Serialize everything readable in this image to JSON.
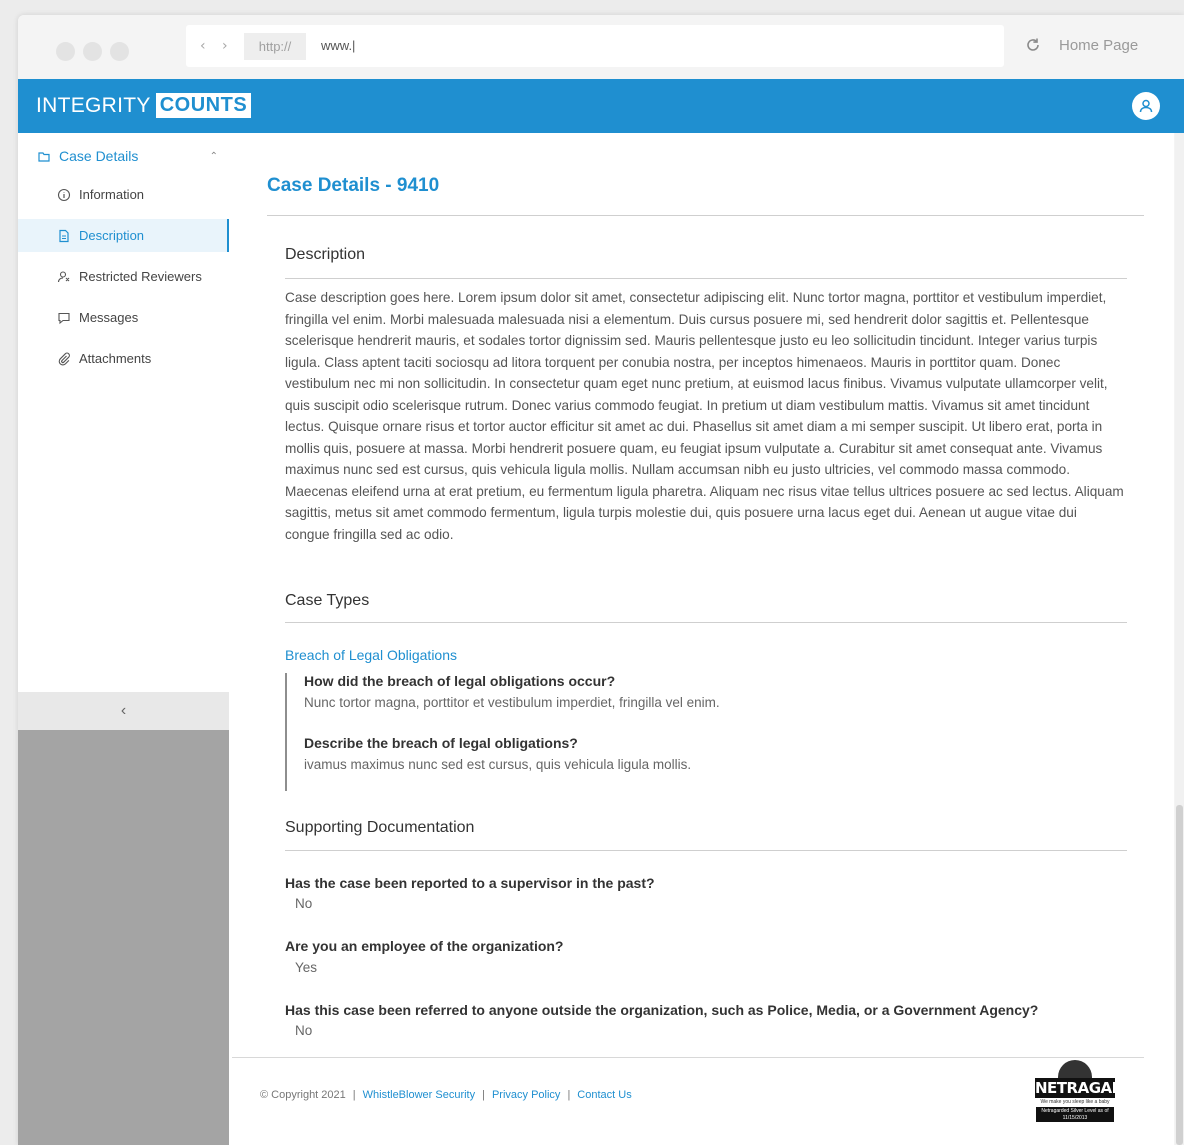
{
  "browser": {
    "nav_arrows": "‹ ›",
    "protocol": "http://",
    "url": "www.|",
    "home_label": "Home Page"
  },
  "header": {
    "logo_part1": "INTEGRITY",
    "logo_part2": "COUNTS",
    "accent_color": "#1f8fd0"
  },
  "sidebar": {
    "section_label": "Case Details",
    "items": [
      {
        "label": "Information",
        "icon": "info-icon"
      },
      {
        "label": "Description",
        "icon": "document-icon",
        "active": true
      },
      {
        "label": "Restricted Reviewers",
        "icon": "reviewers-icon"
      },
      {
        "label": "Messages",
        "icon": "message-icon"
      },
      {
        "label": "Attachments",
        "icon": "paperclip-icon"
      }
    ],
    "collapse_glyph": "‹"
  },
  "main": {
    "title": "Case Details - 9410",
    "description_heading": "Description",
    "description_text": "Case description goes here. Lorem ipsum dolor sit amet, consectetur adipiscing elit. Nunc tortor magna, porttitor et vestibulum imperdiet, fringilla vel enim. Morbi malesuada malesuada nisi a elementum. Duis cursus posuere mi, sed hendrerit dolor sagittis et. Pellentesque scelerisque hendrerit mauris, et sodales tortor dignissim sed. Mauris pellentesque justo eu leo sollicitudin tincidunt. Integer varius turpis ligula. Class aptent taciti sociosqu ad litora torquent per conubia nostra, per inceptos himenaeos. Mauris in porttitor quam. Donec vestibulum nec mi non sollicitudin. In consectetur quam eget nunc pretium, at euismod lacus finibus. Vivamus vulputate ullamcorper velit, quis suscipit odio scelerisque rutrum. Donec varius commodo feugiat. In pretium ut diam vestibulum mattis. Vivamus sit amet tincidunt lectus. Quisque ornare risus et tortor auctor efficitur sit amet ac dui. Phasellus sit amet diam a mi semper suscipit. Ut libero erat, porta in mollis quis, posuere at massa. Morbi hendrerit posuere quam, eu feugiat ipsum vulputate a. Curabitur sit amet consequat ante. Vivamus maximus nunc sed est cursus, quis vehicula ligula mollis. Nullam accumsan nibh eu justo ultricies, vel commodo massa commodo. Maecenas eleifend urna at erat pretium, eu fermentum ligula pharetra. Aliquam nec risus vitae tellus ultrices posuere ac sed lectus. Aliquam sagittis, metus sit amet commodo fermentum, ligula turpis molestie dui, quis posuere urna lacus eget dui. Aenean ut augue vitae dui congue fringilla sed ac odio.",
    "case_types_heading": "Case Types",
    "case_type_link": "Breach of Legal Obligations",
    "case_type_qa": [
      {
        "q": "How did the breach of legal obligations occur?",
        "a": "Nunc tortor magna, porttitor et vestibulum imperdiet, fringilla vel enim."
      },
      {
        "q": "Describe the breach of legal obligations?",
        "a": "ivamus maximus nunc sed est cursus, quis vehicula ligula mollis."
      }
    ],
    "supporting_heading": "Supporting Documentation",
    "supporting_qa": [
      {
        "q": "Has the case been reported to a supervisor in the past?",
        "a": "No"
      },
      {
        "q": "Are you an employee of the organization?",
        "a": "Yes"
      },
      {
        "q": "Has this case been referred to anyone outside the organization, such as Police, Media, or a Government Agency?",
        "a": "No"
      }
    ]
  },
  "footer": {
    "copyright": "© Copyright 2021",
    "separator": "|",
    "links": [
      "WhistleBlower Security",
      "Privacy Policy",
      "Contact Us"
    ],
    "badge_word": "NETRAGARD",
    "badge_tagline": "We make you sleep like a baby",
    "badge_box_text": "Netragarded Silver Level as of 11/15/2013"
  }
}
